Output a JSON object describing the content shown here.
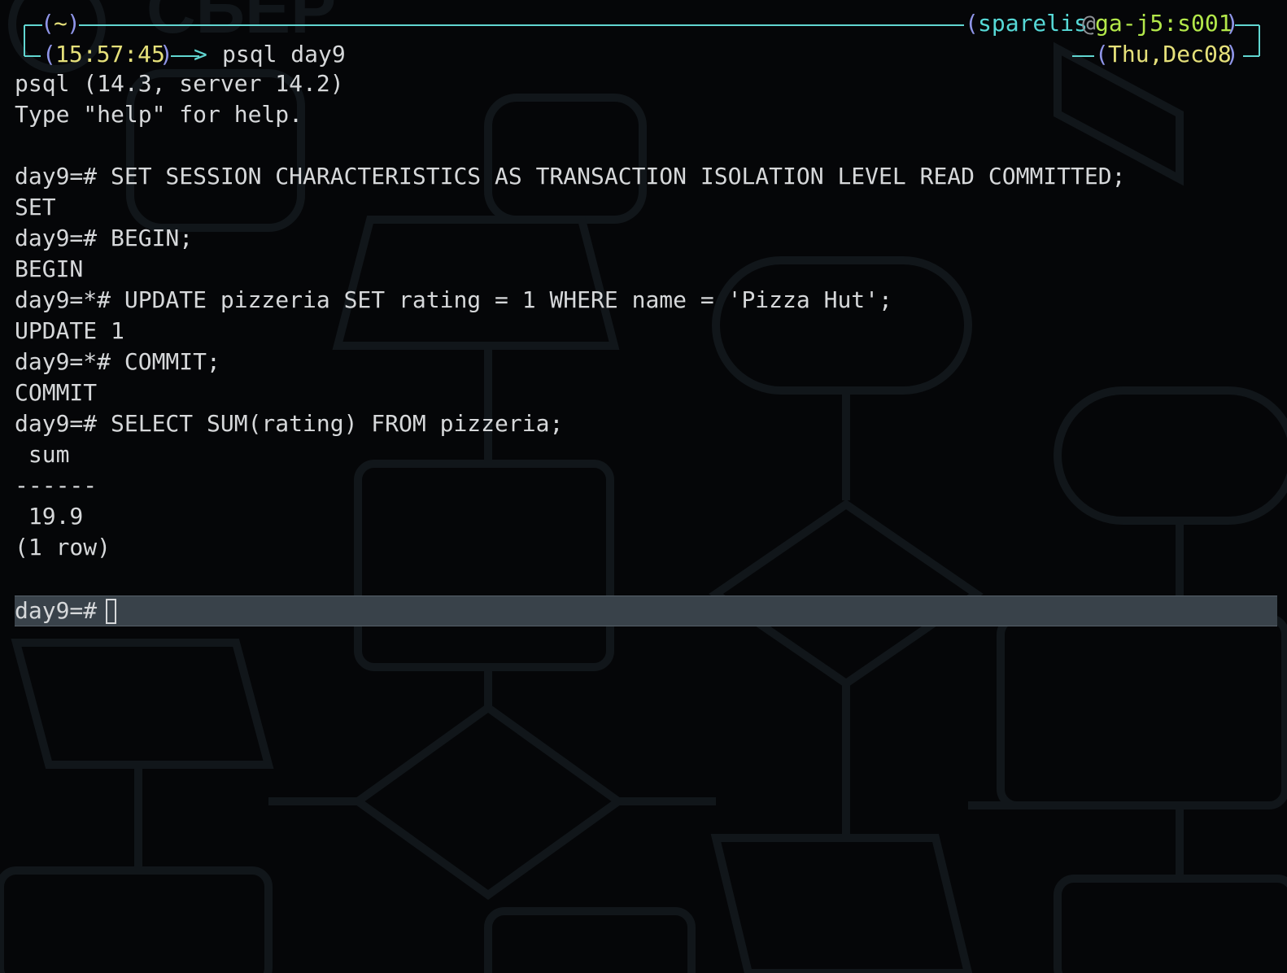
{
  "prompt": {
    "tilde": "~",
    "time": "15:57:45",
    "command": "psql day9",
    "user": "sparelis",
    "at": "@",
    "host": "ga-j5:s001",
    "date": "Thu,Dec08"
  },
  "output_lines": [
    "psql (14.3, server 14.2)",
    "Type \"help\" for help.",
    "",
    "day9=# SET SESSION CHARACTERISTICS AS TRANSACTION ISOLATION LEVEL READ COMMITTED;",
    "SET",
    "day9=# BEGIN;",
    "BEGIN",
    "day9=*# UPDATE pizzeria SET rating = 1 WHERE name = 'Pizza Hut';",
    "UPDATE 1",
    "day9=*# COMMIT;",
    "COMMIT",
    "day9=# SELECT SUM(rating) FROM pizzeria;",
    " sum",
    "------",
    " 19.9",
    "(1 row)"
  ],
  "input": {
    "prompt": "day9=# ",
    "value": ""
  },
  "colors": {
    "background": "#050608",
    "text": "#d6d8da",
    "frame": "#61d6d1",
    "paren": "#8f95e8",
    "yellow": "#e5e07a",
    "cyan": "#56d8d6",
    "green": "#b3e84a",
    "input_bar": "#39424a"
  }
}
